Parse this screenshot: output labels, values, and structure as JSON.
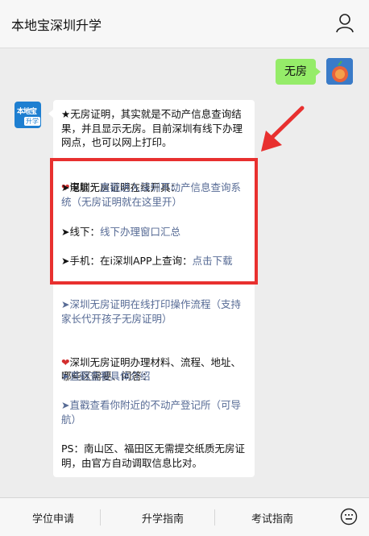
{
  "header": {
    "title": "本地宝深圳升学"
  },
  "chat": {
    "user_message": "无房",
    "bot_avatar": {
      "line1": "本地宝",
      "line2": "升学"
    },
    "bot": {
      "intro": "★无房证明，其实就是不动产信息查询结果，并且显示无房。目前深圳有线下办理网点，也可以网上打印。",
      "section_online_title": "深圳无房证明在线开具：",
      "pc_prefix": "➤电脑：",
      "pc_link": "直戳进入深圳不动产信息查询系统（无房证明就在这里开）",
      "offline_prefix": "➤线下：",
      "offline_link": "线下办理窗口汇总",
      "mobile_prefix": "➤手机：在i深圳APP上查询：",
      "mobile_link": "点击下载",
      "print_link": "➤深圳无房证明在线打印操作流程（支持家长代开孩子无房证明）",
      "materials_title": "深圳无房证明办理材料、流程、地址、哪些区需要、问答：",
      "materials_link": "➤直戳查看具体介绍",
      "nearby_link": "➤直戳查看你附近的不动产登记所（可导航）",
      "ps": "PS：南山区、福田区无需提交纸质无房证明，由官方自动调取信息比对。"
    }
  },
  "footer": {
    "tabs": [
      "学位申请",
      "升学指南",
      "考试指南"
    ]
  },
  "colors": {
    "accent_red": "#e8302f",
    "link": "#576b95",
    "bubble_green": "#95ec69"
  }
}
